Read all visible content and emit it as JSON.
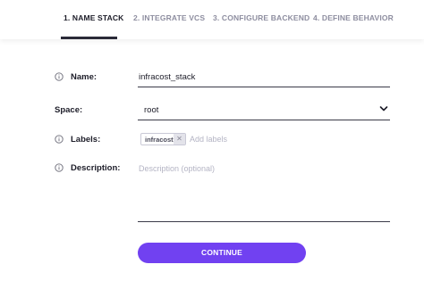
{
  "tabs": [
    {
      "label": "1. NAME STACK",
      "active": true
    },
    {
      "label": "2. INTEGRATE VCS",
      "active": false
    },
    {
      "label": "3. CONFIGURE BACKEND",
      "active": false
    },
    {
      "label": "4. DEFINE BEHAVIOR",
      "active": false
    }
  ],
  "form": {
    "name_label": "Name:",
    "name_value": "infracost_stack",
    "space_label": "Space:",
    "space_value": "root",
    "labels_label": "Labels:",
    "labels_chip": "infracost",
    "labels_placeholder": "Add labels",
    "description_label": "Description:",
    "description_placeholder": "Description (optional)"
  },
  "actions": {
    "continue_label": "CONTINUE"
  },
  "colors": {
    "accent": "#7141f1",
    "text": "#1c1c28",
    "muted": "#8e8ea0"
  },
  "icons": {
    "info": "info-circle-icon",
    "dropdown": "chevron-down-icon",
    "chip_remove": "close-icon"
  }
}
